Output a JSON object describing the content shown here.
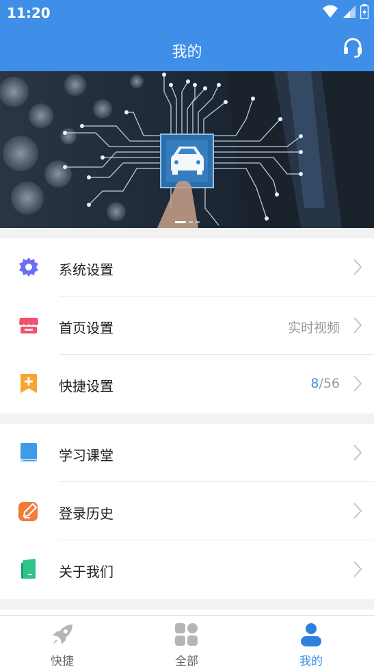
{
  "status_bar": {
    "time": "11:20"
  },
  "header": {
    "title": "我的"
  },
  "menu_group_1": [
    {
      "label": "系统设置",
      "value": "",
      "icon": "settings-gear-icon",
      "color": "#6b6ef5"
    },
    {
      "label": "首页设置",
      "value": "实时视频",
      "icon": "storefront-icon",
      "color": "#f2506e"
    },
    {
      "label": "快捷设置",
      "value_highlight": "8",
      "value_rest": "/56",
      "icon": "bookmark-plus-icon",
      "color": "#f7a531"
    }
  ],
  "menu_group_2": [
    {
      "label": "学习课堂",
      "icon": "book-icon",
      "color": "#3f9ae8"
    },
    {
      "label": "登录历史",
      "icon": "edit-pencil-icon",
      "color": "#f47a3b"
    },
    {
      "label": "关于我们",
      "icon": "phone-card-icon",
      "color": "#2fc38a"
    }
  ],
  "tabbar": {
    "tabs": [
      {
        "label": "快捷",
        "icon": "rocket-icon",
        "active": false
      },
      {
        "label": "全部",
        "icon": "grid-icon",
        "active": false
      },
      {
        "label": "我的",
        "icon": "user-icon",
        "active": true
      }
    ]
  },
  "colors": {
    "primary": "#3f8ee8",
    "highlight": "#3f8ee8"
  }
}
